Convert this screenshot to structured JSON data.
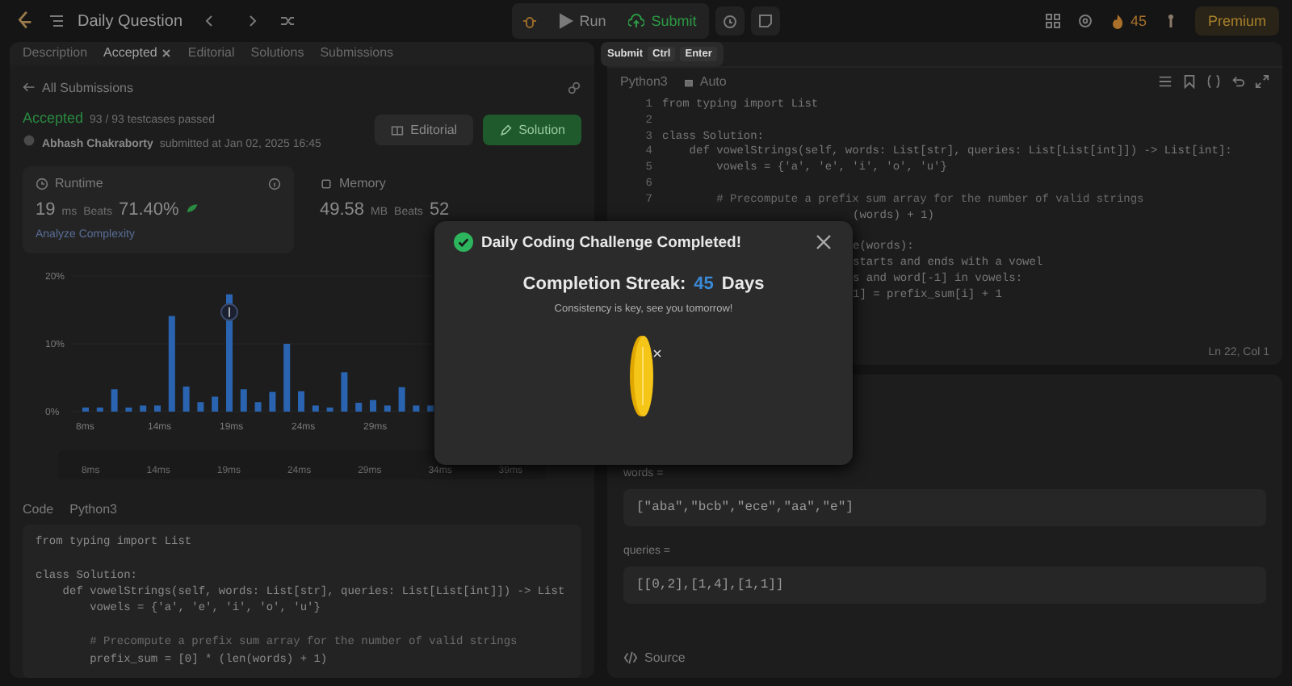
{
  "top_bar": {
    "title": "Daily Question",
    "run": "Run",
    "submit": "Submit",
    "streak": "45",
    "premium": "Premium"
  },
  "tooltip": {
    "label": "Submit",
    "keys": [
      "Ctrl",
      "Enter"
    ]
  },
  "left_tabs": [
    {
      "label": "Description",
      "selected": false,
      "closable": false
    },
    {
      "label": "Accepted",
      "selected": true,
      "closable": true
    },
    {
      "label": "Editorial",
      "selected": false,
      "closable": false
    },
    {
      "label": "Solutions",
      "selected": false,
      "closable": false
    },
    {
      "label": "Submissions",
      "selected": false,
      "closable": false
    }
  ],
  "submission": {
    "back": "All Submissions",
    "status": "Accepted",
    "testcases": "93 / 93 testcases passed",
    "author": "Abhash Chakraborty",
    "submitted": "submitted at Jan 02, 2025 16:45",
    "buttons": [
      {
        "label": "Editorial",
        "kind": "plain"
      },
      {
        "label": "Solution",
        "kind": "primary"
      }
    ]
  },
  "runtime": {
    "title": "Runtime",
    "value": "19",
    "unit": "ms",
    "beats_label": "Beats",
    "beats": "71.40%",
    "analyze": "Analyze Complexity"
  },
  "memory": {
    "title": "Memory",
    "value": "49.58",
    "unit": "MB",
    "beats_label": "Beats",
    "beats": "52"
  },
  "chart_data": {
    "type": "bar",
    "categories": [
      "8ms",
      null,
      null,
      null,
      null,
      "14ms",
      null,
      null,
      null,
      null,
      "19ms",
      null,
      null,
      null,
      null,
      "24ms",
      null,
      null,
      null,
      null,
      "29ms",
      null,
      null,
      null,
      null
    ],
    "series": [
      {
        "color": "#2a64b0",
        "values": [
          0.6,
          0.6,
          3.3,
          0.6,
          0.9,
          0.9,
          14.1,
          3.7,
          1.4,
          2.2,
          17.3,
          3.3,
          1.4,
          2.9,
          10,
          3,
          0.9,
          0.6,
          5.8,
          1.3,
          1.7,
          0.9,
          3.6,
          0.9,
          0.9
        ]
      }
    ],
    "ylim": [
      0,
      20
    ],
    "yticks": [
      {
        "value": 0,
        "label": "0%"
      },
      {
        "value": 10,
        "label": "10%"
      },
      {
        "value": 20,
        "label": "20%"
      }
    ]
  },
  "overview_labels": [
    "8ms",
    "14ms",
    "19ms",
    "24ms",
    "29ms",
    "34ms",
    "39ms"
  ],
  "code_section": {
    "title": "Code",
    "language": "Python3",
    "lines": [
      {
        "text": "from typing import List"
      },
      {
        "kind": "blank"
      },
      {
        "text": "class Solution:"
      },
      {
        "text": "    def vowelStrings(self, words: List[str], queries: List[List[int]]) -> List"
      },
      {
        "text": "        vowels = {'a', 'e', 'i', 'o', 'u'}"
      },
      {
        "kind": "blank"
      },
      {
        "text": "        # Precompute a prefix sum array for the number of valid strings",
        "kind": "comment"
      },
      {
        "text": "        prefix_sum = [0] * (len(words) + 1)"
      }
    ]
  },
  "editor": {
    "language": "Python3",
    "mode": "Auto",
    "lines": [
      {
        "num": "1",
        "text": "from typing import List"
      },
      {
        "num": "2"
      },
      {
        "num": "3",
        "text": "class Solution:"
      },
      {
        "num": "4",
        "text": "    def vowelStrings(self, words: List[str], queries: List[List[int]]) -> List[int]:"
      },
      {
        "num": "5",
        "text": "        vowels = {'a', 'e', 'i', 'o', 'u'}"
      },
      {
        "num": "6"
      },
      {
        "num": "7",
        "text": "        # Precompute a prefix sum array for the number of valid strings",
        "kind": "comment"
      },
      {
        "text": "(words) + 1)",
        "kind": "clipped"
      },
      {
        "kind": "blank"
      },
      {
        "text": "e(words):",
        "kind": "clipped"
      },
      {
        "text": "starts and ends with a vowel",
        "kind": "clipped"
      },
      {
        "text": "s and word[-1] in vowels:",
        "kind": "clipped"
      },
      {
        "text": "1] = prefix_sum[i] + 1",
        "kind": "clipped"
      }
    ],
    "position": "Ln 22, Col 1"
  },
  "testcase": {
    "params": [
      {
        "label": "words =",
        "value": "[\"aba\",\"bcb\",\"ece\",\"aa\",\"e\"]"
      },
      {
        "label": "queries =",
        "value": "[[0,2],[1,4],[1,1]]"
      }
    ],
    "source": "Source"
  },
  "modal": {
    "title": "Daily Coding Challenge Completed!",
    "streak_label": "Completion Streak:",
    "streak": "45",
    "streak_unit": "Days",
    "message": "Consistency is key, see you tomorrow!"
  }
}
